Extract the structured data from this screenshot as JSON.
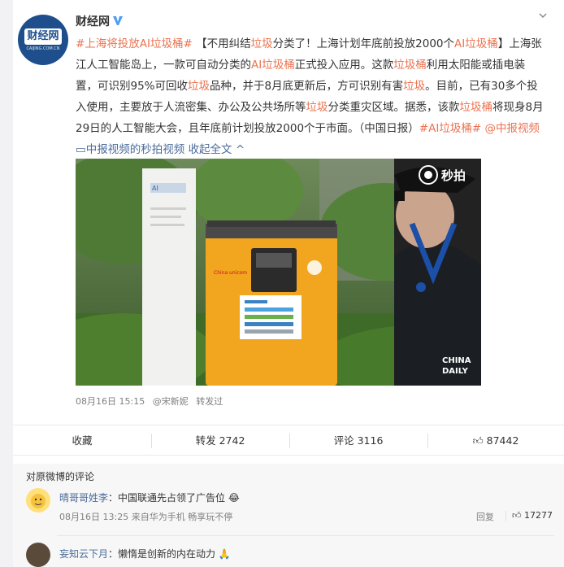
{
  "post": {
    "username": "财经网",
    "topic1": "#上海将投放AI垃圾桶#",
    "sentence_a1": "【不用纠结",
    "kw_lj": "垃圾",
    "sentence_a2": "分类了！上海计划年底前投放2000个",
    "kw_ai": "AI垃圾桶",
    "sentence_a3": "】上海张江人工智能岛上，一款可自动分类的",
    "sentence_a4": "正式投入应用。这款",
    "kw_ljt": "垃圾桶",
    "sentence_a5": "利用太阳能或插电装置，可识别95%可回收",
    "sentence_a6": "品种，并于8月底更新后，方可识别有害",
    "sentence_a7": "。目前，已有30多个投入使用，主要放于人流密集、办公及公共场所等",
    "sentence_a8": "分类重灾区域。据悉，该款",
    "sentence_a9": "将现身8月29日的人工智能大会，且年底前计划投放2000个于市面。（中国日报）",
    "topic2": "#AI垃圾桶#",
    "mention": "@中报视频",
    "video_link": "中报视频的秒拍视频",
    "collapse": "收起全文"
  },
  "video": {
    "watermark": "秒拍",
    "brand_line1": "CHINA",
    "brand_line2": "DAILY",
    "bin_brand": "China unicom",
    "sign_brand": "AI"
  },
  "meta": {
    "time": "08月16日 15:15",
    "via": "@宋新妮",
    "repost": "转发过"
  },
  "actions": {
    "favorite": "收藏",
    "repost_label": "转发",
    "repost_count": "2742",
    "comment_label": "评论",
    "comment_count": "3116",
    "like_count": "87442"
  },
  "comments": {
    "title": "对原微博的评论",
    "items": [
      {
        "name": "晴哥哥姓李",
        "colon": "：",
        "text": "中国联通先占领了广告位",
        "time": "08月16日 13:25",
        "source": "来自华为手机 畅享玩不停",
        "reply": "回复",
        "likes": "17277"
      },
      {
        "name": "妄知云下月",
        "colon": "：",
        "text": "懒惰是创新的内在动力"
      }
    ]
  },
  "colors": {
    "link": "#eb7350",
    "name": "#4a6b9a",
    "vip": "#f5a623",
    "bin": "#f2a51e"
  }
}
